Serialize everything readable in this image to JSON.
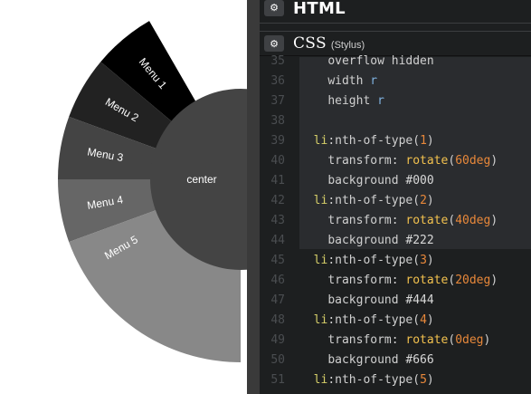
{
  "preview": {
    "menu_items": [
      {
        "label": "Menu 1",
        "color": "#000000"
      },
      {
        "label": "Menu 2",
        "color": "#222222"
      },
      {
        "label": "Menu 3",
        "color": "#444444"
      },
      {
        "label": "Menu 4",
        "color": "#666666"
      },
      {
        "label": "Menu 5",
        "color": "#888888"
      }
    ],
    "center_label": "center",
    "center_color": "#444444"
  },
  "html_editor": {
    "title": "HTML",
    "settings_icon": "gear-icon"
  },
  "css_editor": {
    "title": "CSS",
    "subtitle": "(Stylus)",
    "settings_icon": "gear-icon"
  },
  "code_lines": [
    {
      "num": "35",
      "indent": "    ",
      "tokens": [
        {
          "t": "overflow hidden",
          "c": "prop"
        }
      ]
    },
    {
      "num": "36",
      "indent": "    ",
      "tokens": [
        {
          "t": "width ",
          "c": "prop"
        },
        {
          "t": "r",
          "c": "var"
        }
      ]
    },
    {
      "num": "37",
      "indent": "    ",
      "tokens": [
        {
          "t": "height ",
          "c": "prop"
        },
        {
          "t": "r",
          "c": "var"
        }
      ]
    },
    {
      "num": "38",
      "indent": "",
      "tokens": []
    },
    {
      "num": "39",
      "indent": "  ",
      "tokens": [
        {
          "t": "li",
          "c": "sel"
        },
        {
          "t": ":nth-of-type(",
          "c": "plain"
        },
        {
          "t": "1",
          "c": "num"
        },
        {
          "t": ")",
          "c": "plain"
        }
      ]
    },
    {
      "num": "40",
      "indent": "    ",
      "tokens": [
        {
          "t": "transform: ",
          "c": "prop"
        },
        {
          "t": "rotate",
          "c": "fn"
        },
        {
          "t": "(",
          "c": "plain"
        },
        {
          "t": "60deg",
          "c": "num"
        },
        {
          "t": ")",
          "c": "plain"
        }
      ]
    },
    {
      "num": "41",
      "indent": "    ",
      "tokens": [
        {
          "t": "background ",
          "c": "prop"
        },
        {
          "t": "#000",
          "c": "hex"
        }
      ]
    },
    {
      "num": "42",
      "indent": "  ",
      "tokens": [
        {
          "t": "li",
          "c": "sel"
        },
        {
          "t": ":nth-of-type(",
          "c": "plain"
        },
        {
          "t": "2",
          "c": "num"
        },
        {
          "t": ")",
          "c": "plain"
        }
      ]
    },
    {
      "num": "43",
      "indent": "    ",
      "tokens": [
        {
          "t": "transform: ",
          "c": "prop"
        },
        {
          "t": "rotate",
          "c": "fn"
        },
        {
          "t": "(",
          "c": "plain"
        },
        {
          "t": "40deg",
          "c": "num"
        },
        {
          "t": ")",
          "c": "plain"
        }
      ]
    },
    {
      "num": "44",
      "indent": "    ",
      "tokens": [
        {
          "t": "background ",
          "c": "prop"
        },
        {
          "t": "#222",
          "c": "hex"
        }
      ]
    },
    {
      "num": "45",
      "indent": "  ",
      "tokens": [
        {
          "t": "li",
          "c": "sel"
        },
        {
          "t": ":nth-of-type(",
          "c": "plain"
        },
        {
          "t": "3",
          "c": "num"
        },
        {
          "t": ")",
          "c": "plain"
        }
      ]
    },
    {
      "num": "46",
      "indent": "    ",
      "tokens": [
        {
          "t": "transform: ",
          "c": "prop"
        },
        {
          "t": "rotate",
          "c": "fn"
        },
        {
          "t": "(",
          "c": "plain"
        },
        {
          "t": "20deg",
          "c": "num"
        },
        {
          "t": ")",
          "c": "plain"
        }
      ]
    },
    {
      "num": "47",
      "indent": "    ",
      "tokens": [
        {
          "t": "background ",
          "c": "prop"
        },
        {
          "t": "#444",
          "c": "hex"
        }
      ]
    },
    {
      "num": "48",
      "indent": "  ",
      "tokens": [
        {
          "t": "li",
          "c": "sel"
        },
        {
          "t": ":nth-of-type(",
          "c": "plain"
        },
        {
          "t": "4",
          "c": "num"
        },
        {
          "t": ")",
          "c": "plain"
        }
      ]
    },
    {
      "num": "49",
      "indent": "    ",
      "tokens": [
        {
          "t": "transform: ",
          "c": "prop"
        },
        {
          "t": "rotate",
          "c": "fn"
        },
        {
          "t": "(",
          "c": "plain"
        },
        {
          "t": "0deg",
          "c": "num"
        },
        {
          "t": ")",
          "c": "plain"
        }
      ]
    },
    {
      "num": "50",
      "indent": "    ",
      "tokens": [
        {
          "t": "background ",
          "c": "prop"
        },
        {
          "t": "#666",
          "c": "hex"
        }
      ]
    },
    {
      "num": "51",
      "indent": "  ",
      "tokens": [
        {
          "t": "li",
          "c": "sel"
        },
        {
          "t": ":nth-of-type(",
          "c": "plain"
        },
        {
          "t": "5",
          "c": "num"
        },
        {
          "t": ")",
          "c": "plain"
        }
      ]
    }
  ]
}
